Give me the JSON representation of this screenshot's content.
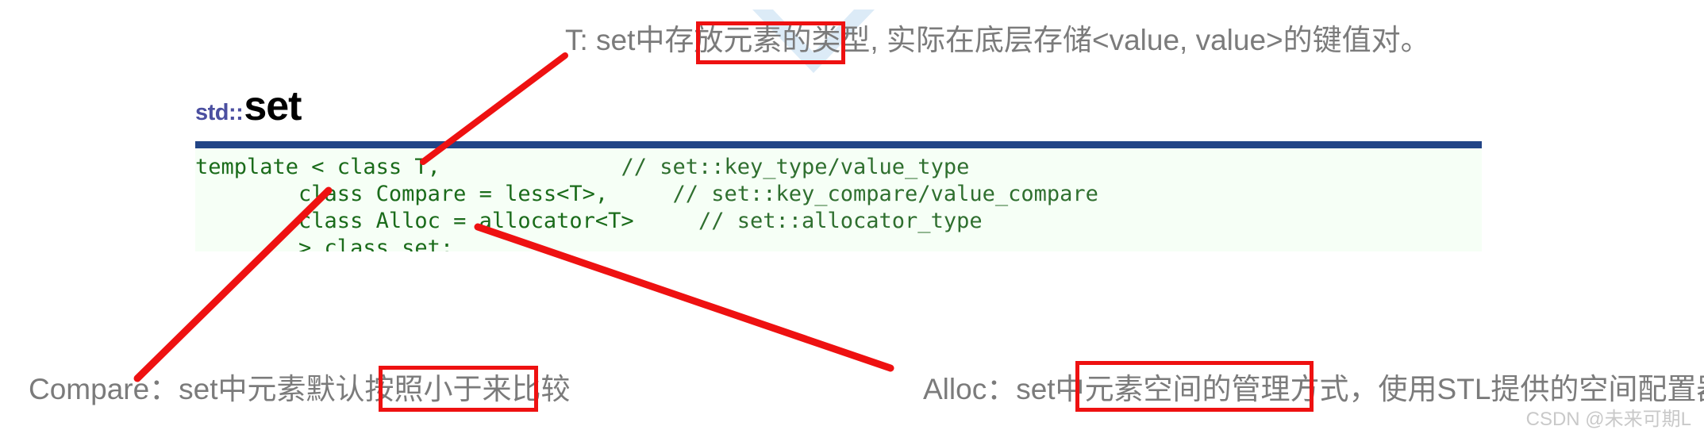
{
  "heading": {
    "namespace": "std::",
    "name": "set"
  },
  "code": {
    "lines": [
      {
        "code": "template < class T,",
        "comment": "// set::key_type/value_type"
      },
      {
        "code": "        class Compare = less<T>,",
        "comment": "// set::key_compare/value_compare"
      },
      {
        "code": "        class Alloc = allocator<T>",
        "comment": "// set::allocator_type"
      },
      {
        "code": "        > class set;",
        "comment": ""
      }
    ]
  },
  "annotations": {
    "top": {
      "before": "T: set中存放",
      "highlight": "元素的类型",
      "after": ", 实际在底层存储<value, value>的键值对。"
    },
    "compare": {
      "before": "Compare：set中元素默认按照",
      "highlight": "小于来比较",
      "after": ""
    },
    "alloc": {
      "before": "Alloc：set中",
      "highlight": "元素空间的管理方式",
      "after": "，使用STL提供的空间配置器管理"
    }
  },
  "watermark": {
    "text": "CSDN @未来可期L"
  },
  "colors": {
    "rule_blue": "#224486",
    "namespace_blue": "#4b4fa0",
    "code_green": "#1a6b1a",
    "code_bg": "#f6fff6",
    "highlight_red": "#ee1111",
    "annotation_gray": "#7b7b7b",
    "watermark_gray": "#c9c9c9"
  }
}
